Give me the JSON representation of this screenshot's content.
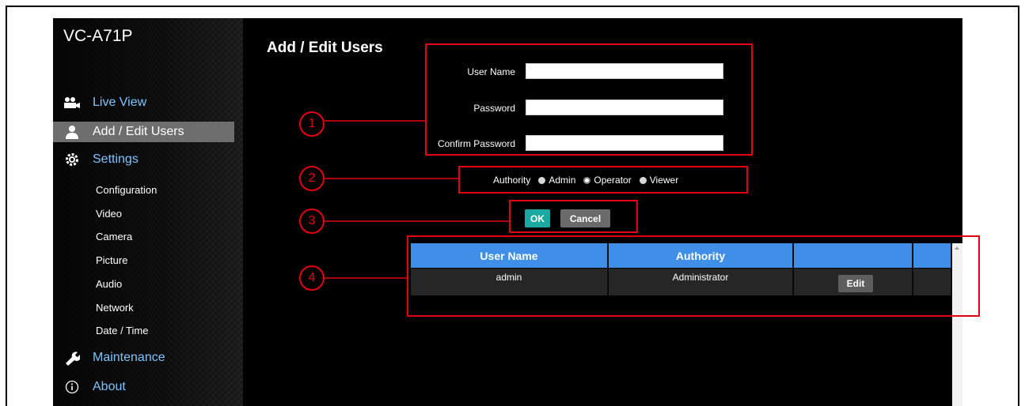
{
  "app": {
    "model_name": "VC-A71P"
  },
  "sidebar": {
    "nav_items": [
      {
        "label": "Live View",
        "icon": "video-camera-icon"
      },
      {
        "label": "Add / Edit Users",
        "icon": "user-icon",
        "active": true
      },
      {
        "label": "Settings",
        "icon": "gear-icon"
      },
      {
        "label": "Maintenance",
        "icon": "wrench-icon"
      },
      {
        "label": "About",
        "icon": "info-icon"
      }
    ],
    "sub_items": [
      "Configuration",
      "Video",
      "Camera",
      "Picture",
      "Audio",
      "Network",
      "Date / Time"
    ]
  },
  "main": {
    "title": "Add / Edit Users",
    "form": {
      "username_label": "User Name",
      "username_value": "",
      "password_label": "Password",
      "password_value": "",
      "confirm_label": "Confirm Password",
      "confirm_value": "",
      "authority_label": "Authority",
      "authority_options": [
        "Admin",
        "Operator",
        "Viewer"
      ],
      "authority_selected": "Operator"
    },
    "buttons": {
      "ok": "OK",
      "cancel": "Cancel"
    },
    "table": {
      "columns": [
        "User Name",
        "Authority",
        "",
        ""
      ],
      "rows": [
        {
          "user_name": "admin",
          "authority": "Administrator",
          "action": "Edit"
        }
      ]
    }
  },
  "callouts": [
    "1",
    "2",
    "3",
    "4"
  ],
  "colors": {
    "callout": "#e3000f",
    "table_header": "#3f8fe8",
    "ok_button": "#1aa8a0",
    "nav_link": "#7fc4ff"
  }
}
